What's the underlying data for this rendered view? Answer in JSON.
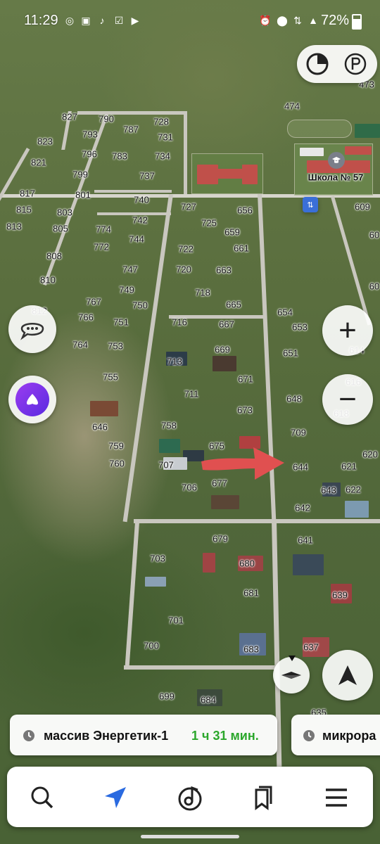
{
  "status_bar": {
    "time": "11:29",
    "battery": "72%",
    "left_icons": [
      "whatsapp-icon",
      "instagram-icon",
      "tiktok-icon",
      "check-box-icon",
      "youtube-icon"
    ],
    "right_icons": [
      "alarm-icon",
      "location-pin-icon",
      "wifi-icon",
      "signal-icon",
      "battery-icon"
    ]
  },
  "map": {
    "poi_school": "Школа № 57",
    "labels": [
      "827",
      "790",
      "728",
      "823",
      "793",
      "787",
      "731",
      "821",
      "796",
      "783",
      "734",
      "799",
      "737",
      "817",
      "801",
      "740",
      "815",
      "803",
      "727",
      "656",
      "813",
      "805",
      "774",
      "742",
      "725",
      "659",
      "609",
      "808",
      "772",
      "744",
      "722",
      "661",
      "747",
      "720",
      "663",
      "810",
      "749",
      "718",
      "767",
      "750",
      "665",
      "654",
      "812",
      "766",
      "751",
      "716",
      "667",
      "653",
      "764",
      "753",
      "669",
      "651",
      "614",
      "755",
      "713",
      "671",
      "616",
      "711",
      "673",
      "648",
      "618",
      "758",
      "709",
      "646",
      "759",
      "675",
      "620",
      "760",
      "707",
      "644",
      "621",
      "677",
      "643",
      "622",
      "706",
      "642",
      "679",
      "641",
      "703",
      "680",
      "681",
      "639",
      "701",
      "700",
      "683",
      "637",
      "699",
      "684",
      "635",
      "474",
      "473",
      "60",
      "60"
    ],
    "accent_arrow_color": "#e05050"
  },
  "controls": {
    "zoom_in": "+",
    "zoom_out": "−"
  },
  "chips": [
    {
      "destination": "массив Энергетик-1",
      "eta": "1 ч 31 мин."
    },
    {
      "destination": "микрора"
    }
  ],
  "bottom_nav": [
    "search-icon",
    "navigate-icon",
    "music-icon",
    "bookmarks-icon",
    "menu-icon"
  ],
  "colors": {
    "eta_green": "#2ba72b",
    "nav_accent": "#2a6ae0"
  }
}
